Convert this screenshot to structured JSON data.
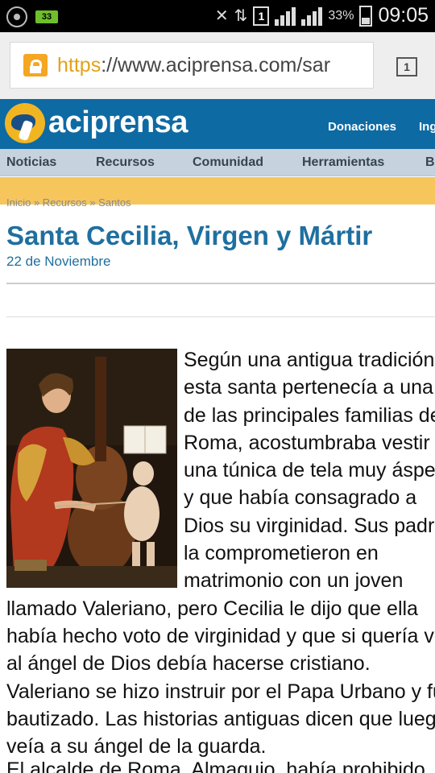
{
  "status_bar": {
    "notif_badge": "33",
    "sim_slot": "1",
    "battery_pct": "33%",
    "time": "09:05"
  },
  "browser": {
    "url_scheme": "https",
    "url_rest": "://www.aciprensa.com/sar",
    "tab_count": "1"
  },
  "header": {
    "logo_text": "aciprensa",
    "links": [
      "Donaciones",
      "Ing"
    ]
  },
  "nav": {
    "items": [
      "Noticias",
      "Recursos",
      "Comunidad",
      "Herramientas",
      "Bi"
    ]
  },
  "breadcrumb": "Inicio » Recursos » Santos",
  "article": {
    "title": "Santa Cecilia, Virgen y Mártir",
    "date": "22 de Noviembre",
    "paragraph": "Según una antigua tradición, esta santa pertenecía a una de las principales familias de Roma, acostumbraba vestir una túnica de tela muy áspera y que había consagrado a Dios su virginidad. Sus padres la comprometieron en matrimonio con un joven llamado Valeriano, pero Cecilia le dijo que ella había hecho voto de virginidad y que si quería ver al ángel de Dios debía hacerse cristiano. Valeriano se hizo instruir por el Papa Urbano y fue bautizado. Las historias antiguas dicen que luego veía a su ángel de la guarda.",
    "next_paragraph_start": "El alcalde de Roma, Almaquio, había prohibido"
  }
}
